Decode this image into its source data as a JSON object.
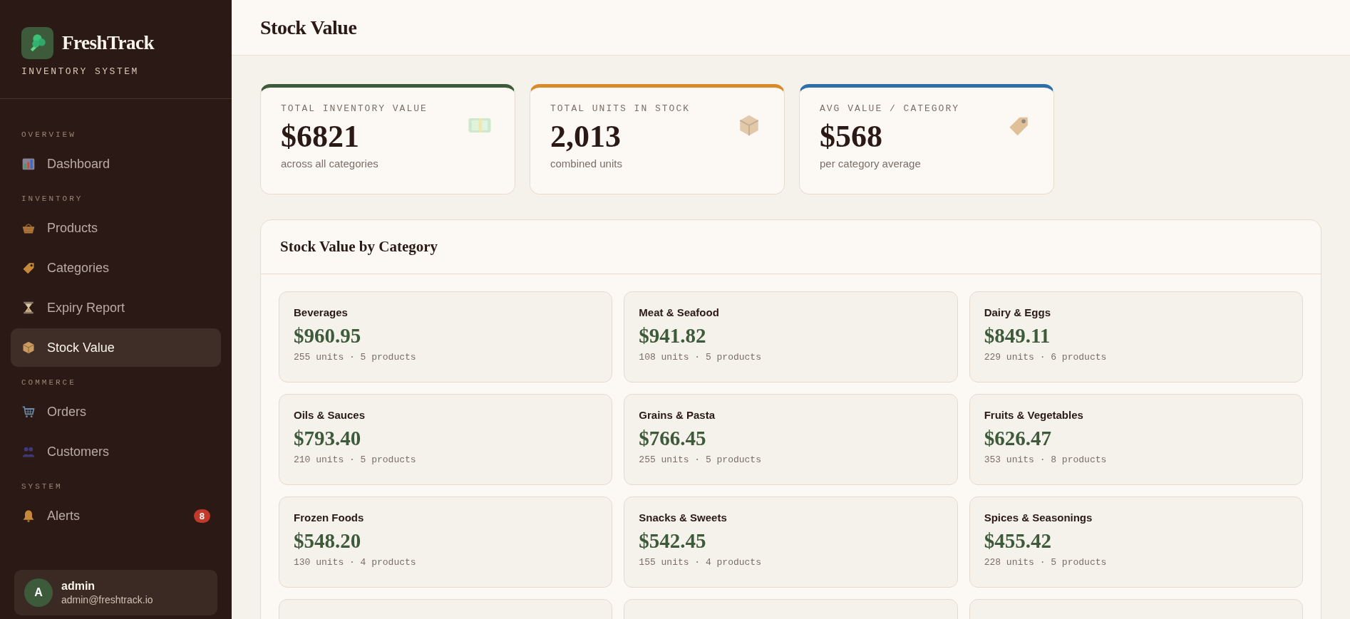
{
  "sidebar": {
    "brand": {
      "name": "FreshTrack",
      "subtitle": "INVENTORY SYSTEM"
    },
    "sections": [
      {
        "heading": "OVERVIEW",
        "items": [
          {
            "label": "Dashboard",
            "selected": false
          }
        ]
      },
      {
        "heading": "INVENTORY",
        "items": [
          {
            "label": "Products",
            "selected": false
          },
          {
            "label": "Categories",
            "selected": false
          },
          {
            "label": "Expiry Report",
            "selected": false
          },
          {
            "label": "Stock Value",
            "selected": true
          }
        ]
      },
      {
        "heading": "COMMERCE",
        "items": [
          {
            "label": "Orders",
            "selected": false
          },
          {
            "label": "Customers",
            "selected": false
          }
        ]
      },
      {
        "heading": "SYSTEM",
        "items": [
          {
            "label": "Alerts",
            "selected": false,
            "badge": "8"
          }
        ]
      }
    ],
    "user": {
      "initial": "A",
      "name": "admin",
      "email": "admin@freshtrack.io"
    }
  },
  "page_title": "Stock Value",
  "stats": [
    {
      "label": "TOTAL INVENTORY VALUE",
      "value": "$6821",
      "note": "across all categories",
      "color": "#3d5a3a"
    },
    {
      "label": "TOTAL UNITS IN STOCK",
      "value": "2,013",
      "note": "combined units",
      "color": "#d98a2b"
    },
    {
      "label": "AVG VALUE / CATEGORY",
      "value": "$568",
      "note": "per category average",
      "color": "#2f6fa8"
    }
  ],
  "panel": {
    "title": "Stock Value by Category",
    "categories": [
      {
        "kind": "card",
        "name": "Beverages",
        "value": "$960.95",
        "meta": "255 units · 5 products"
      },
      {
        "kind": "card",
        "name": "Meat & Seafood",
        "value": "$941.82",
        "meta": "108 units · 5 products"
      },
      {
        "kind": "card",
        "name": "Dairy & Eggs",
        "value": "$849.11",
        "meta": "229 units · 6 products"
      },
      {
        "kind": "card",
        "name": "Oils & Sauces",
        "value": "$793.40",
        "meta": "210 units · 5 products"
      },
      {
        "kind": "card",
        "name": "Grains & Pasta",
        "value": "$766.45",
        "meta": "255 units · 5 products"
      },
      {
        "kind": "card",
        "name": "Fruits & Vegetables",
        "value": "$626.47",
        "meta": "353 units · 8 products"
      },
      {
        "kind": "card",
        "name": "Frozen Foods",
        "value": "$548.20",
        "meta": "130 units · 4 products"
      },
      {
        "kind": "card",
        "name": "Snacks & Sweets",
        "value": "$542.45",
        "meta": "155 units · 4 products"
      },
      {
        "kind": "card",
        "name": "Spices & Seasonings",
        "value": "$455.42",
        "meta": "228 units · 5 products"
      },
      {
        "kind": "cut"
      },
      {
        "kind": "cut"
      },
      {
        "kind": "cut"
      }
    ]
  }
}
